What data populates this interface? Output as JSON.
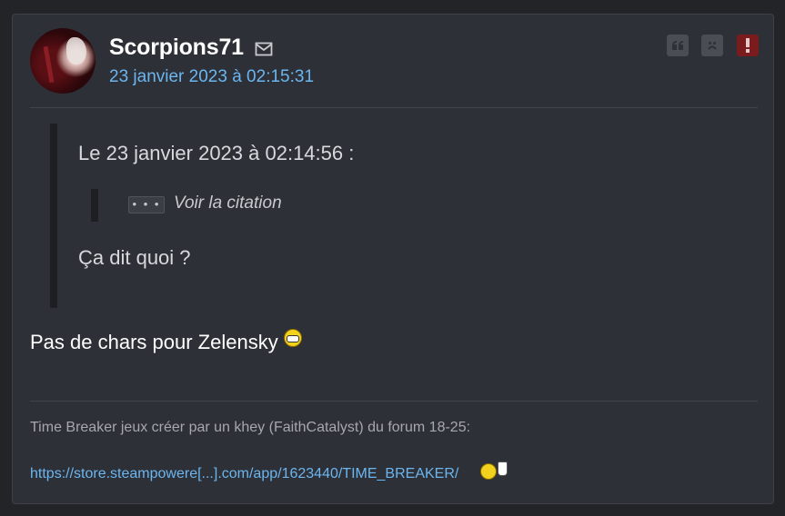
{
  "post": {
    "author": "Scorpions71",
    "date": "23 janvier 2023 à 02:15:31",
    "actions": {
      "quote": "quote-icon",
      "kick": "sad-face-icon",
      "report": "exclamation-icon"
    },
    "quote": {
      "header": "Le 23 janvier 2023 à 02:14:56 :",
      "nested_button": "• • •",
      "nested_label": "Voir la citation",
      "text": "Ça dit quoi ?"
    },
    "message": "Pas de chars pour Zelensky",
    "signature": {
      "text": "Time Breaker jeux créer par un khey (FaithCatalyst) du forum 18-25:",
      "link": "https://store.steampowere[...].com/app/1623440/TIME_BREAKER/"
    }
  },
  "colors": {
    "background": "#232428",
    "card": "#2d3037",
    "link": "#6cb6f0",
    "report": "#7a1b1d"
  }
}
